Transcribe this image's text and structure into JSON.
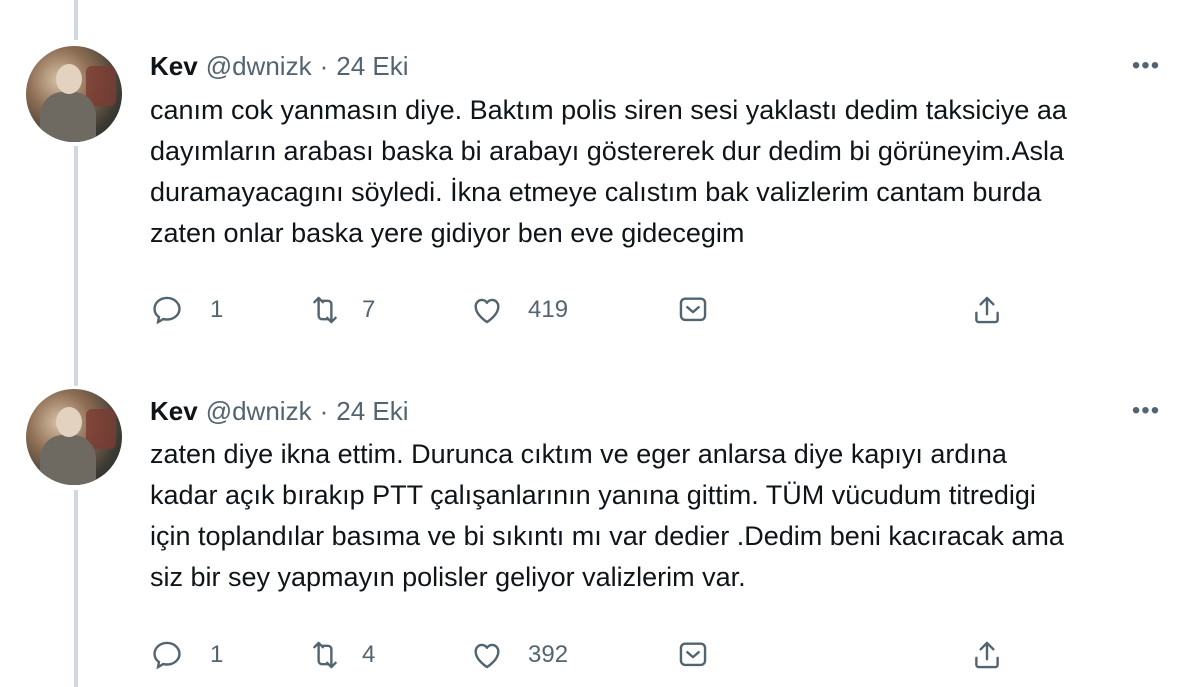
{
  "tweets": [
    {
      "author_name": "Kev",
      "handle": "@dwnizk",
      "separator": "·",
      "date": "24 Eki",
      "more_label": "•••",
      "text": "canım cok yanmasın diye. Baktım polis siren sesi yaklastı dedim taksiciye aa\ndayımların arabası baska bi arabayı göstererek dur dedim bi görüneyim.Asla\nduramayacagını söyledi. İkna etmeye calıstım bak valizlerim cantam burda\nzaten onlar baska yere gidiyor ben eve gidecegim",
      "reply_count": "1",
      "retweet_count": "7",
      "like_count": "419"
    },
    {
      "author_name": "Kev",
      "handle": "@dwnizk",
      "separator": "·",
      "date": "24 Eki",
      "more_label": "•••",
      "text": "zaten diye ikna ettim. Durunca cıktım ve eger anlarsa diye kapıyı ardına\nkadar açık bırakıp PTT çalışanlarının yanına gittim. TÜM vücudum titredigi\niçin toplandılar basıma ve bi sıkıntı mı var dedier .Dedim beni kacıracak ama\nsiz bir sey yapmayın polisler geliyor valizlerim var.",
      "reply_count": "1",
      "retweet_count": "4",
      "like_count": "392"
    }
  ],
  "icons": {
    "reply": "reply-icon",
    "retweet": "retweet-icon",
    "like": "heart-icon",
    "bookmark": "bookmark-icon",
    "share": "share-icon"
  },
  "colors": {
    "text_primary": "#0f1419",
    "text_secondary": "#536471",
    "thread_line": "#cfd9de"
  }
}
